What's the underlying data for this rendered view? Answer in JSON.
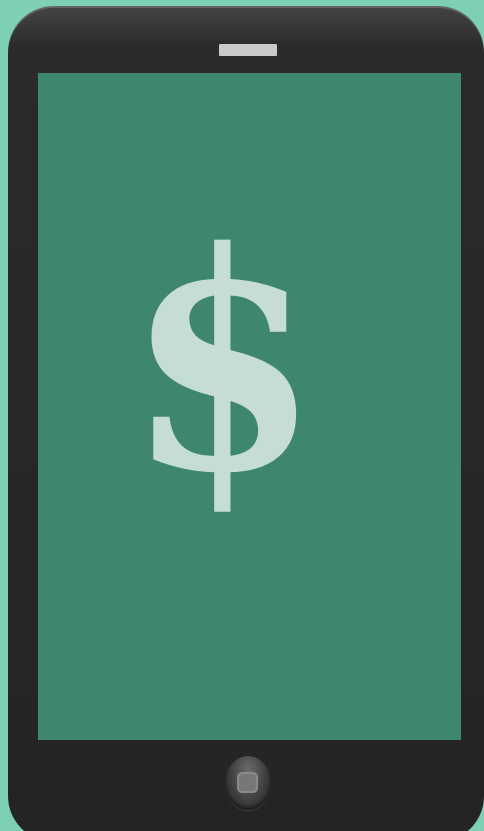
{
  "screen": {
    "glyph": "$",
    "background_color": "#3e876d",
    "glyph_color": "#c5ddd6"
  },
  "device": {
    "frame_color": "#262626",
    "page_background": "#7dcfb6",
    "icons": [
      "speaker-grille-icon",
      "home-button-icon"
    ]
  }
}
